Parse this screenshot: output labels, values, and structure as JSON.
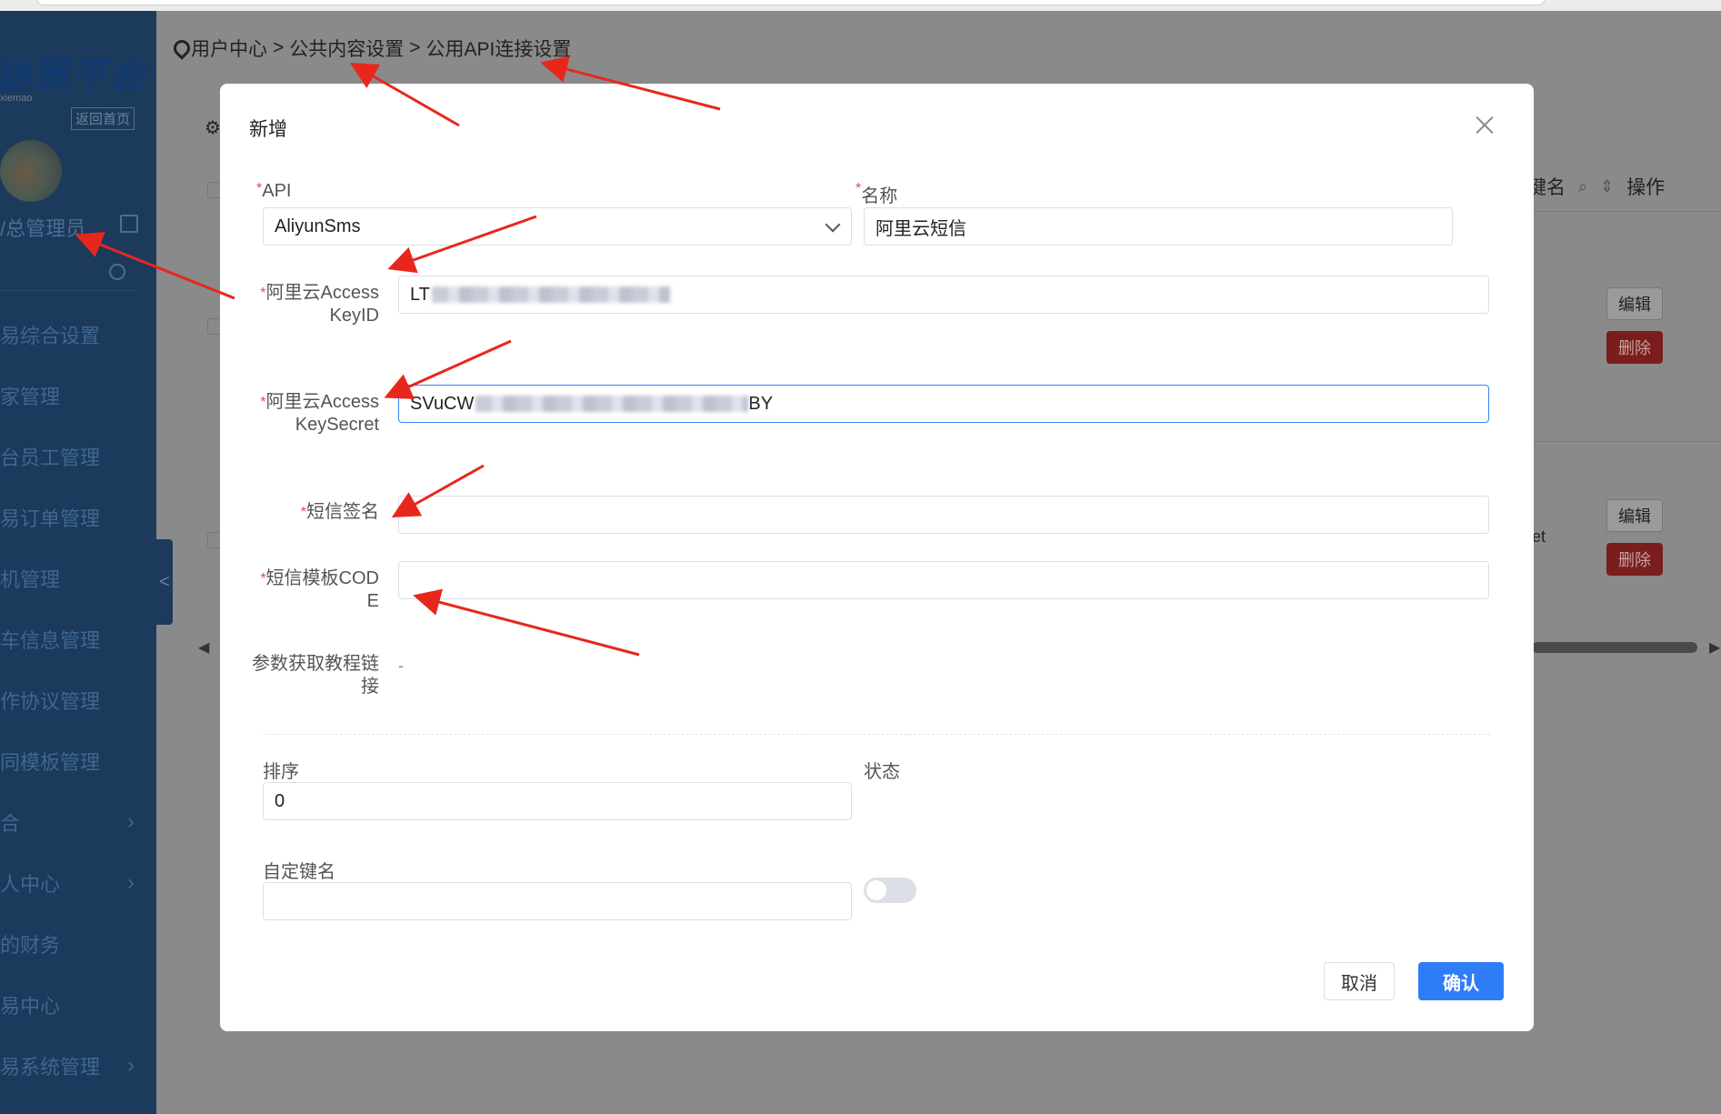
{
  "sidebar": {
    "logo": "协贸平台",
    "logo_sub": "xiemao",
    "back_home": "返回首页",
    "admin_name": "/总管理员",
    "menu": [
      {
        "label": "易综合设置",
        "chevron": false
      },
      {
        "label": "家管理",
        "chevron": false
      },
      {
        "label": "台员工管理",
        "chevron": false
      },
      {
        "label": "易订单管理",
        "chevron": false
      },
      {
        "label": "机管理",
        "chevron": false
      },
      {
        "label": "车信息管理",
        "chevron": false
      },
      {
        "label": "作协议管理",
        "chevron": false
      },
      {
        "label": "同模板管理",
        "chevron": false
      },
      {
        "label": "合",
        "chevron": true
      },
      {
        "label": "人中心",
        "chevron": true
      },
      {
        "label": "的财务",
        "chevron": false
      },
      {
        "label": "易中心",
        "chevron": false
      },
      {
        "label": "易系统管理",
        "chevron": true
      }
    ],
    "collapse": "<"
  },
  "breadcrumb": {
    "items": [
      "用户中心",
      "公共内容设置",
      "公用API连接设置"
    ],
    "separator": ">"
  },
  "background_table": {
    "header_partial": "键名",
    "header_ops": "操作",
    "edit_label": "编辑",
    "delete_label": "删除",
    "cell_partial": "et"
  },
  "modal": {
    "title": "新增",
    "fields": {
      "api": {
        "label": "API",
        "value": "AliyunSms"
      },
      "name": {
        "label": "名称",
        "value": "阿里云短信"
      },
      "access_key_id": {
        "label": "阿里云AccessKeyID",
        "value_prefix": "LT"
      },
      "access_key_secret": {
        "label": "阿里云AccessKeySecret",
        "value_prefix": "SVuCW",
        "value_suffix": "BY"
      },
      "sms_sign": {
        "label": "短信签名",
        "value": ""
      },
      "sms_template": {
        "label": "短信模板CODE",
        "value": ""
      },
      "tutorial": {
        "label": "参数获取教程链接",
        "value": "-"
      },
      "sort": {
        "label": "排序",
        "value": "0"
      },
      "status": {
        "label": "状态",
        "on": false
      },
      "custom_key": {
        "label": "自定键名",
        "value": ""
      }
    },
    "cancel": "取消",
    "confirm": "确认"
  },
  "colors": {
    "primary": "#2f7df6",
    "required": "#e34d4d",
    "annotation": "#e8271c",
    "sidebar": "#1b3a5c"
  }
}
